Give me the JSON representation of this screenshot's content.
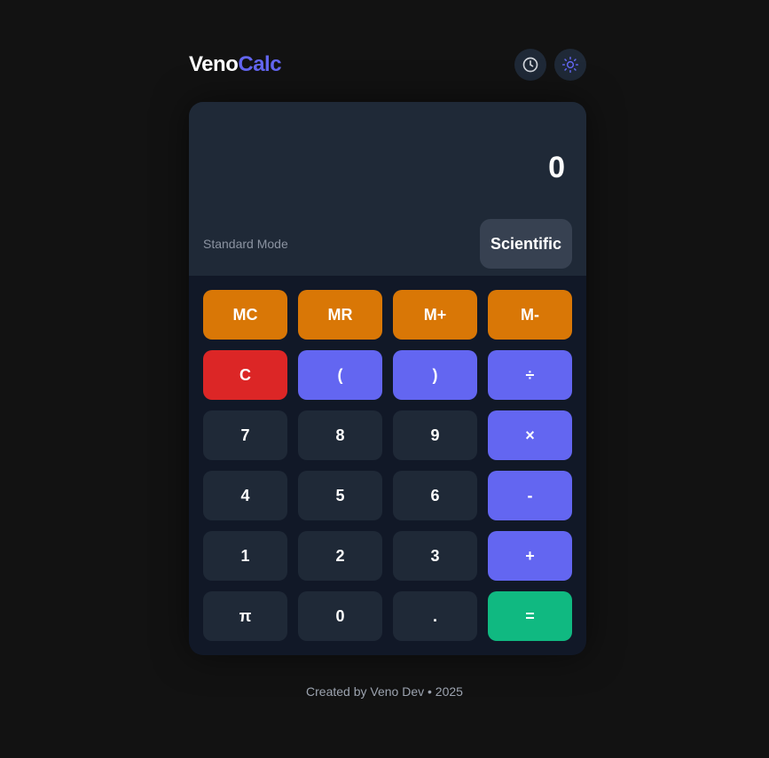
{
  "header": {
    "brand_part1": "Veno",
    "brand_part2": "Calc",
    "history_icon": "clock-icon",
    "theme_icon": "sun-icon"
  },
  "display": {
    "value": "0",
    "mode_label": "Standard Mode",
    "mode_toggle_label": "Scientific"
  },
  "keys": [
    {
      "label": "MC",
      "kind": "memory",
      "name": "memory-clear-button"
    },
    {
      "label": "MR",
      "kind": "memory",
      "name": "memory-recall-button"
    },
    {
      "label": "M+",
      "kind": "memory",
      "name": "memory-add-button"
    },
    {
      "label": "M-",
      "kind": "memory",
      "name": "memory-subtract-button"
    },
    {
      "label": "C",
      "kind": "clear",
      "name": "clear-button"
    },
    {
      "label": "(",
      "kind": "operator",
      "name": "open-paren-button"
    },
    {
      "label": ")",
      "kind": "operator",
      "name": "close-paren-button"
    },
    {
      "label": "÷",
      "kind": "operator",
      "name": "divide-button"
    },
    {
      "label": "7",
      "kind": "digit",
      "name": "digit-7-button"
    },
    {
      "label": "8",
      "kind": "digit",
      "name": "digit-8-button"
    },
    {
      "label": "9",
      "kind": "digit",
      "name": "digit-9-button"
    },
    {
      "label": "×",
      "kind": "operator",
      "name": "multiply-button"
    },
    {
      "label": "4",
      "kind": "digit",
      "name": "digit-4-button"
    },
    {
      "label": "5",
      "kind": "digit",
      "name": "digit-5-button"
    },
    {
      "label": "6",
      "kind": "digit",
      "name": "digit-6-button"
    },
    {
      "label": "-",
      "kind": "operator",
      "name": "subtract-button"
    },
    {
      "label": "1",
      "kind": "digit",
      "name": "digit-1-button"
    },
    {
      "label": "2",
      "kind": "digit",
      "name": "digit-2-button"
    },
    {
      "label": "3",
      "kind": "digit",
      "name": "digit-3-button"
    },
    {
      "label": "+",
      "kind": "operator",
      "name": "add-button"
    },
    {
      "label": "π",
      "kind": "digit",
      "name": "pi-button"
    },
    {
      "label": "0",
      "kind": "digit",
      "name": "digit-0-button"
    },
    {
      "label": ".",
      "kind": "digit",
      "name": "decimal-button"
    },
    {
      "label": "=",
      "kind": "equals",
      "name": "equals-button"
    }
  ],
  "colors": {
    "accent": "#6366f1",
    "memory": "#d97706",
    "clear": "#dc2626",
    "equals": "#10b981",
    "key": "#1f2937"
  },
  "footer": {
    "text": "Created by Veno Dev • 2025"
  }
}
